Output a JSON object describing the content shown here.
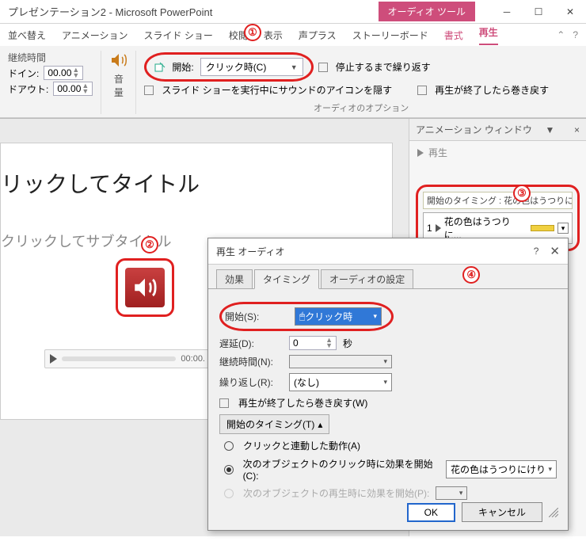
{
  "title": "プレゼンテーション2 - Microsoft PowerPoint",
  "audio_tools_tab": "オーディオ ツール",
  "menu": {
    "arrange": "並べ替え",
    "animation": "アニメーション",
    "slideshow": "スライド ショー",
    "review": "校閲",
    "view": "表示",
    "voiceplus": "声プラス",
    "storyboard": "ストーリーボード",
    "format": "書式",
    "playback": "再生"
  },
  "ribbon": {
    "duration_label": "継続時間",
    "fadein_label": "ドイン:",
    "fadeout_label": "ドアウト:",
    "fadein_val": "00.00",
    "fadeout_val": "00.00",
    "volume_label": "音量",
    "start_label": "開始:",
    "start_value": "クリック時(C)",
    "loop_label": "停止するまで繰り返す",
    "hide_icon_label": "スライド ショーを実行中にサウンドのアイコンを隠す",
    "rewind_label": "再生が終了したら巻き戻す",
    "group_label": "オーディオのオプション"
  },
  "anim_pane": {
    "title": "アニメーション ウィンドウ",
    "play_btn": "再生",
    "trigger_row": "開始のタイミング : 花の色はうつりにけり...",
    "item_num": "1",
    "item_text": "花の色はうつりに..."
  },
  "slide": {
    "title": "リックしてタイトル",
    "sub": "クリックしてサブタイトル",
    "time": "00:00."
  },
  "dialog": {
    "title": "再生 オーディオ",
    "tabs": {
      "effect": "効果",
      "timing": "タイミング",
      "audio": "オーディオの設定"
    },
    "start_label": "開始(S):",
    "start_value": "クリック時",
    "delay_label": "遅延(D):",
    "delay_value": "0",
    "delay_unit": "秒",
    "duration_label": "継続時間(N):",
    "repeat_label": "繰り返し(R):",
    "repeat_value": "(なし)",
    "rewind_chk": "再生が終了したら巻き戻す(W)",
    "trigger_btn": "開始のタイミング(T)",
    "radio1": "クリックと連動した動作(A)",
    "radio2": "次のオブジェクトのクリック時に効果を開始(C):",
    "radio2_val": "花の色はうつりにけりないたづら...",
    "radio3": "次のオブジェクトの再生時に効果を開始(P):",
    "ok": "OK",
    "cancel": "キャンセル"
  },
  "callouts": {
    "c1": "①",
    "c2": "②",
    "c3": "③",
    "c4": "④"
  }
}
